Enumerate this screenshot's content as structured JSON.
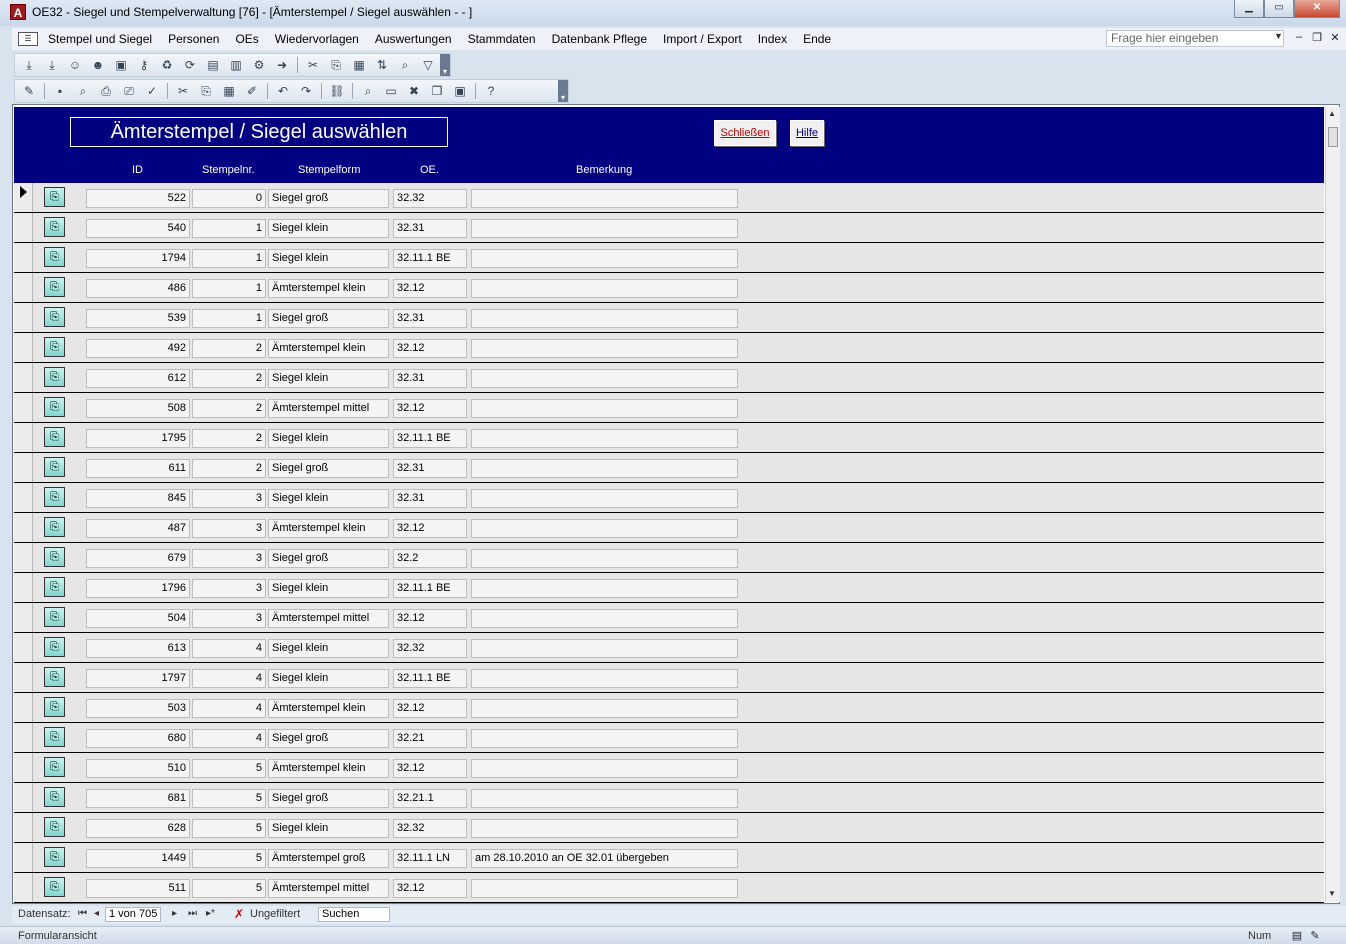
{
  "window": {
    "app_icon": "A",
    "title": "OE32 - Siegel und Stempelverwaltung [76] - [Ämterstempel / Siegel auswählen -  - ]"
  },
  "menu": {
    "items": [
      "Stempel und Siegel",
      "Personen",
      "OEs",
      "Wiedervorlagen",
      "Auswertungen",
      "Stammdaten",
      "Datenbank Pflege",
      "Import / Export",
      "Index",
      "Ende"
    ],
    "ask_placeholder": "Frage hier eingeben"
  },
  "form": {
    "title": "Ämterstempel / Siegel auswählen",
    "close_label": "Schließen",
    "help_label": "Hilfe",
    "columns": {
      "id": "ID",
      "nr": "Stempelnr.",
      "form": "Stempelform",
      "oe": "OE.",
      "bem": "Bemerkung"
    }
  },
  "rows": [
    {
      "id": "522",
      "nr": "0",
      "form": "Siegel groß",
      "oe": "32.32",
      "bem": ""
    },
    {
      "id": "540",
      "nr": "1",
      "form": "Siegel klein",
      "oe": "32.31",
      "bem": ""
    },
    {
      "id": "1794",
      "nr": "1",
      "form": "Siegel klein",
      "oe": "32.11.1 BE",
      "bem": ""
    },
    {
      "id": "486",
      "nr": "1",
      "form": "Ämterstempel klein",
      "oe": "32.12",
      "bem": ""
    },
    {
      "id": "539",
      "nr": "1",
      "form": "Siegel groß",
      "oe": "32.31",
      "bem": ""
    },
    {
      "id": "492",
      "nr": "2",
      "form": "Ämterstempel klein",
      "oe": "32.12",
      "bem": ""
    },
    {
      "id": "612",
      "nr": "2",
      "form": "Siegel klein",
      "oe": "32.31",
      "bem": ""
    },
    {
      "id": "508",
      "nr": "2",
      "form": "Ämterstempel mittel",
      "oe": "32.12",
      "bem": ""
    },
    {
      "id": "1795",
      "nr": "2",
      "form": "Siegel klein",
      "oe": "32.11.1 BE",
      "bem": ""
    },
    {
      "id": "611",
      "nr": "2",
      "form": "Siegel groß",
      "oe": "32.31",
      "bem": ""
    },
    {
      "id": "845",
      "nr": "3",
      "form": "Siegel klein",
      "oe": "32.31",
      "bem": ""
    },
    {
      "id": "487",
      "nr": "3",
      "form": "Ämterstempel klein",
      "oe": "32.12",
      "bem": ""
    },
    {
      "id": "679",
      "nr": "3",
      "form": "Siegel groß",
      "oe": "32.2",
      "bem": ""
    },
    {
      "id": "1796",
      "nr": "3",
      "form": "Siegel klein",
      "oe": "32.11.1 BE",
      "bem": ""
    },
    {
      "id": "504",
      "nr": "3",
      "form": "Ämterstempel mittel",
      "oe": "32.12",
      "bem": ""
    },
    {
      "id": "613",
      "nr": "4",
      "form": "Siegel klein",
      "oe": "32.32",
      "bem": ""
    },
    {
      "id": "1797",
      "nr": "4",
      "form": "Siegel klein",
      "oe": "32.11.1 BE",
      "bem": ""
    },
    {
      "id": "503",
      "nr": "4",
      "form": "Ämterstempel klein",
      "oe": "32.12",
      "bem": ""
    },
    {
      "id": "680",
      "nr": "4",
      "form": "Siegel groß",
      "oe": "32.21",
      "bem": ""
    },
    {
      "id": "510",
      "nr": "5",
      "form": "Ämterstempel klein",
      "oe": "32.12",
      "bem": ""
    },
    {
      "id": "681",
      "nr": "5",
      "form": "Siegel groß",
      "oe": "32.21.1",
      "bem": ""
    },
    {
      "id": "628",
      "nr": "5",
      "form": "Siegel klein",
      "oe": "32.32",
      "bem": ""
    },
    {
      "id": "1449",
      "nr": "5",
      "form": "Ämterstempel groß",
      "oe": "32.11.1 LN",
      "bem": "am 28.10.2010 an OE 32.01 übergeben"
    },
    {
      "id": "511",
      "nr": "5",
      "form": "Ämterstempel mittel",
      "oe": "32.12",
      "bem": ""
    }
  ],
  "nav": {
    "label": "Datensatz:",
    "record_value": "1 von 705",
    "filter_label": "Ungefiltert",
    "search_value": "Suchen"
  },
  "status": {
    "left": "Formularansicht",
    "num": "Num"
  }
}
